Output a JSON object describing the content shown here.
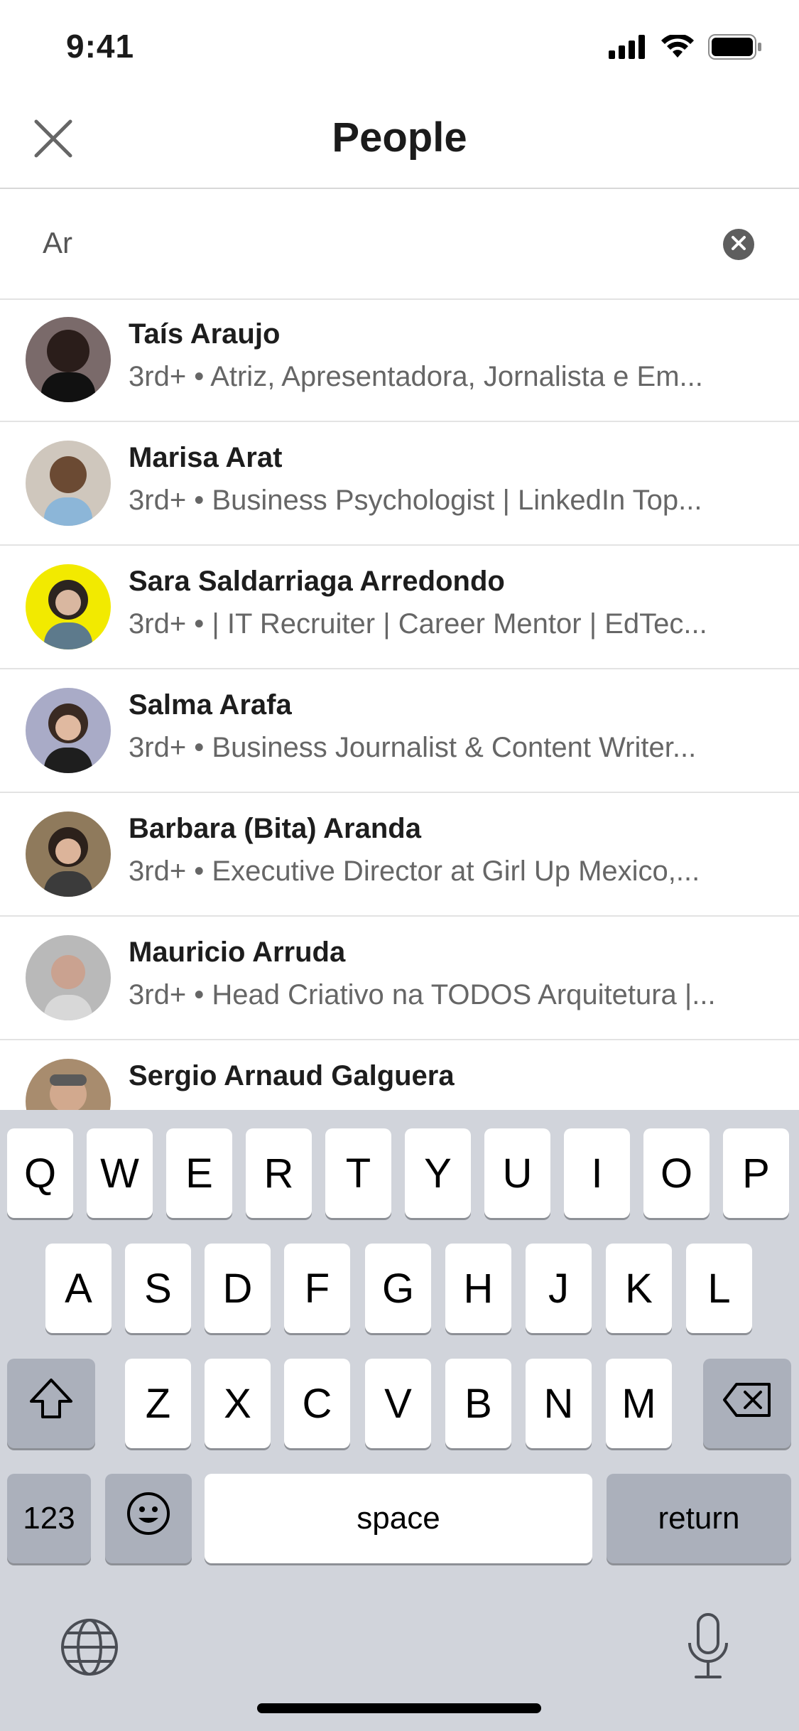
{
  "status_bar": {
    "time": "9:41"
  },
  "header": {
    "title": "People"
  },
  "search": {
    "value": "Ar"
  },
  "results": [
    {
      "name": "Taís Araujo",
      "subtitle": "3rd+ • Atriz, Apresentadora, Jornalista e Em...",
      "avatar_bg": "#7a6a6a"
    },
    {
      "name": "Marisa Arat",
      "subtitle": "3rd+ • Business Psychologist | LinkedIn Top...",
      "avatar_bg": "#cfc7bd"
    },
    {
      "name": "Sara Saldarriaga Arredondo",
      "subtitle": "3rd+ • | IT Recruiter | Career Mentor | EdTec...",
      "avatar_bg": "#f2ea00"
    },
    {
      "name": "Salma Arafa",
      "subtitle": "3rd+ • Business Journalist & Content Writer...",
      "avatar_bg": "#a9abc7"
    },
    {
      "name": "Barbara (Bita) Aranda",
      "subtitle": "3rd+ • Executive Director at Girl Up Mexico,...",
      "avatar_bg": "#8f7a5c"
    },
    {
      "name": "Mauricio Arruda",
      "subtitle": "3rd+ • Head Criativo na TODOS Arquitetura |...",
      "avatar_bg": "#b9b9b9"
    },
    {
      "name": "Sergio Arnaud Galguera",
      "subtitle": "",
      "avatar_bg": "#a88c6e"
    }
  ],
  "keyboard": {
    "row1": [
      "Q",
      "W",
      "E",
      "R",
      "T",
      "Y",
      "U",
      "I",
      "O",
      "P"
    ],
    "row2": [
      "A",
      "S",
      "D",
      "F",
      "G",
      "H",
      "J",
      "K",
      "L"
    ],
    "row3": [
      "Z",
      "X",
      "C",
      "V",
      "B",
      "N",
      "M"
    ],
    "numbers_label": "123",
    "space_label": "space",
    "return_label": "return"
  }
}
